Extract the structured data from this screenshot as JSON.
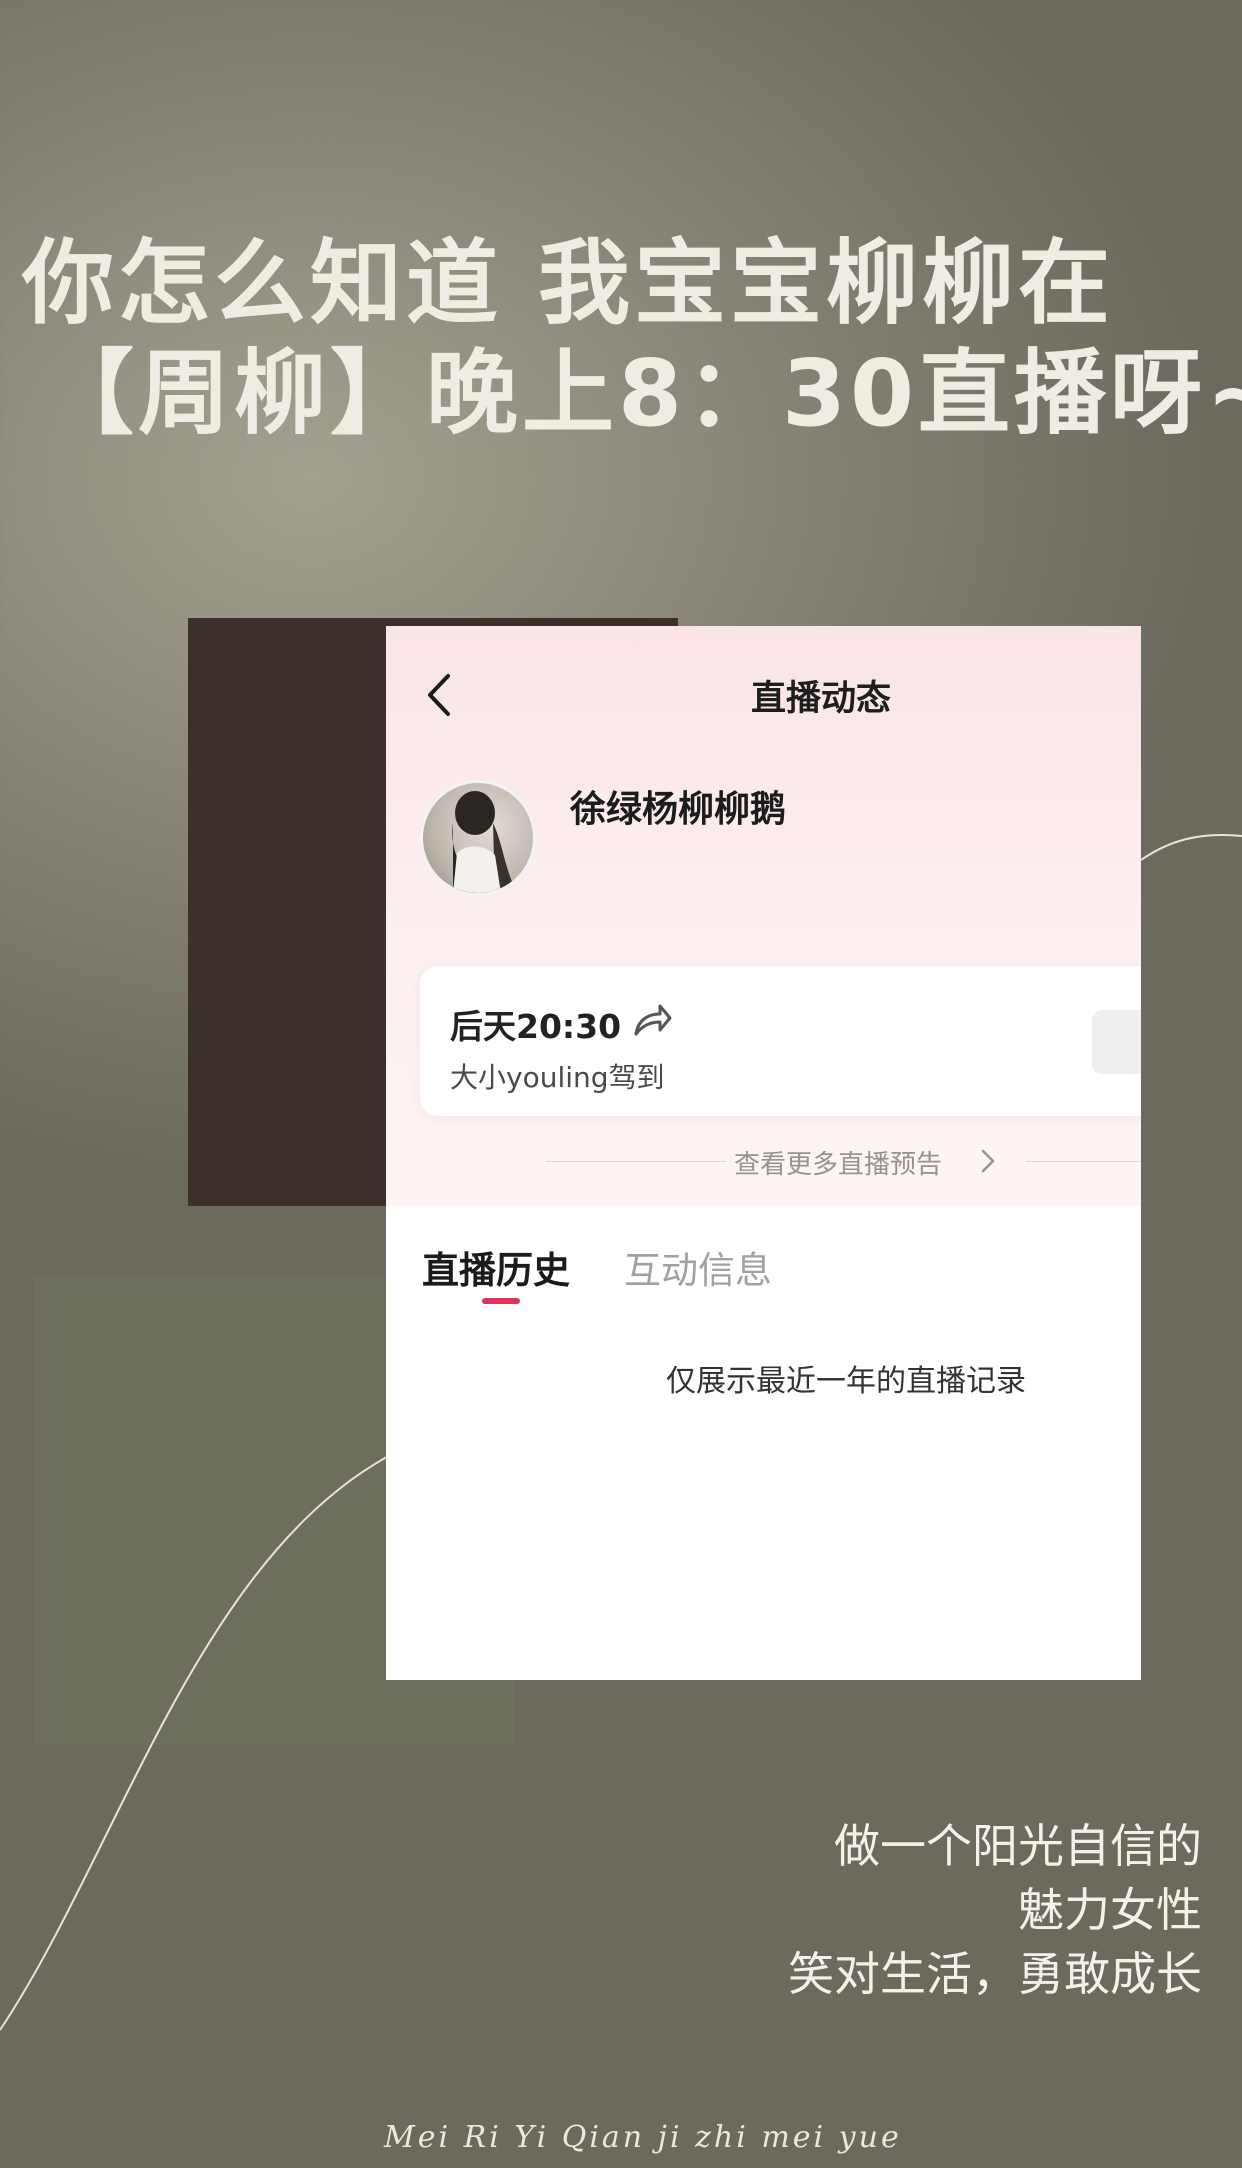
{
  "poster": {
    "headline_line1": "你怎么知道 我宝宝柳柳在",
    "headline_line2": "【周柳】晚上8：30直播呀~",
    "slogan_line1": "做一个阳光自信的",
    "slogan_line2": "魅力女性",
    "slogan_line3": "笑对生活，勇敢成长",
    "footer_script": "Mei Ri Yi Qian ji zhi mei yue"
  },
  "screen": {
    "title": "直播动态",
    "back_icon": "chevron-left-icon",
    "profile": {
      "username": "徐绿杨柳柳鹅"
    },
    "preview": {
      "time": "后天20:30",
      "share_icon": "share-arrow-icon",
      "subtitle": "大小youling驾到"
    },
    "more_link": "查看更多直播预告",
    "tabs": [
      {
        "label": "直播历史",
        "active": true
      },
      {
        "label": "互动信息",
        "active": false
      }
    ],
    "empty_note": "仅展示最近一年的直播记录"
  },
  "colors": {
    "accent": "#e0355a",
    "headline": "#efece3",
    "dark_block": "#3b302a",
    "green_block": "#6d6e5e"
  }
}
